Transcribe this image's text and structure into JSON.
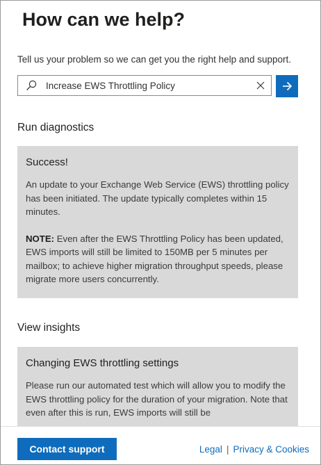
{
  "header": {
    "title": "How can we help?",
    "subtitle": "Tell us your problem so we can get you the right help and support."
  },
  "search": {
    "value": "Increase EWS Throttling Policy",
    "search_icon": "search-icon",
    "clear_icon": "close-icon",
    "submit_icon": "arrow-right-icon"
  },
  "diagnostics": {
    "heading": "Run diagnostics",
    "card": {
      "title": "Success!",
      "paragraph": "An update to your Exchange Web Service (EWS) throttling policy has been initiated. The update typically completes within 15 minutes.",
      "note_label": "NOTE:",
      "note_text": " Even after the EWS Throttling Policy has been updated, EWS imports will still be limited to 150MB per 5 minutes per mailbox; to achieve higher migration throughput speeds, please migrate more users concurrently."
    }
  },
  "insights": {
    "heading": "View insights",
    "card": {
      "title": "Changing EWS throttling settings",
      "paragraph": "Please run our automated test which will allow you to modify the EWS throttling policy for the duration of your migration. Note that even after this is run, EWS imports will still be"
    }
  },
  "footer": {
    "contact_label": "Contact support",
    "legal_label": "Legal",
    "separator": "|",
    "privacy_label": "Privacy & Cookies"
  },
  "colors": {
    "accent": "#0f6cbd",
    "card_background": "#d9d9d9"
  }
}
